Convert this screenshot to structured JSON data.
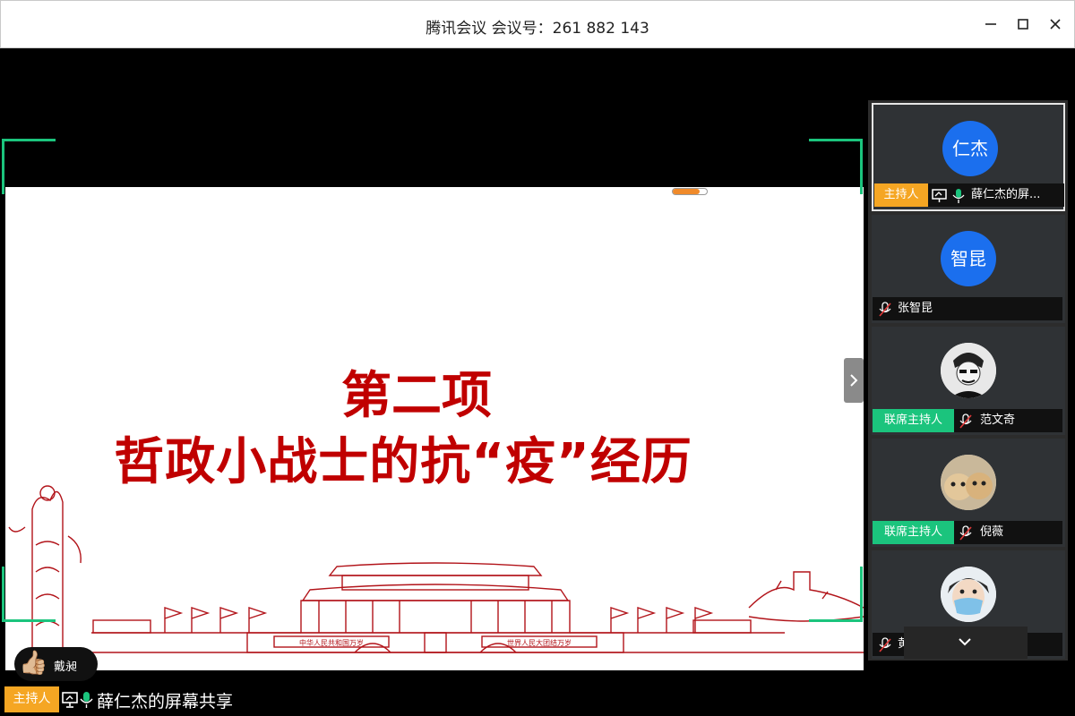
{
  "window": {
    "title": "腾讯会议 会议号：261 882 143"
  },
  "slide": {
    "heading": "第二项",
    "subheading": "哲政小战士的抗“疫”经历",
    "banner_left": "中华人民共和国万岁",
    "banner_right": "世界人民大团结万岁",
    "progress_percent": 80,
    "accent_color": "#c00000"
  },
  "reaction": {
    "emoji": "👍🏼",
    "name": "戴昶"
  },
  "status": {
    "role": "主持人",
    "text": "薛仁杰的屏幕共享"
  },
  "participants": [
    {
      "avatar_text": "仁杰",
      "role": "主持人",
      "name": "薛仁杰的屏...",
      "active": true,
      "sharing": true,
      "mic": "on"
    },
    {
      "avatar_text": "智昆",
      "role": "",
      "name": "张智昆",
      "active": false,
      "sharing": false,
      "mic": "muted"
    },
    {
      "avatar_text": "",
      "role": "联席主持人",
      "name": "范文奇",
      "active": false,
      "sharing": false,
      "mic": "muted",
      "photo": "cartoon-face"
    },
    {
      "avatar_text": "",
      "role": "联席主持人",
      "name": "倪薇",
      "active": false,
      "sharing": false,
      "mic": "muted",
      "photo": "cats"
    },
    {
      "avatar_text": "",
      "role": "",
      "name": "黄雨纯",
      "active": false,
      "sharing": false,
      "mic": "muted",
      "photo": "child-mask"
    }
  ],
  "colors": {
    "host": "#f5a623",
    "cohost": "#1bc47d",
    "avatar_blue": "#1b6fee",
    "share_frame": "#1bc47d"
  },
  "icons": {
    "minimize": "minimize-icon",
    "maximize": "maximize-icon",
    "close": "close-icon",
    "screen_share": "screen-share-icon",
    "mic_on": "mic-icon",
    "mic_muted": "mic-muted-icon",
    "next": "chevron-right-icon",
    "more": "chevron-down-icon"
  }
}
